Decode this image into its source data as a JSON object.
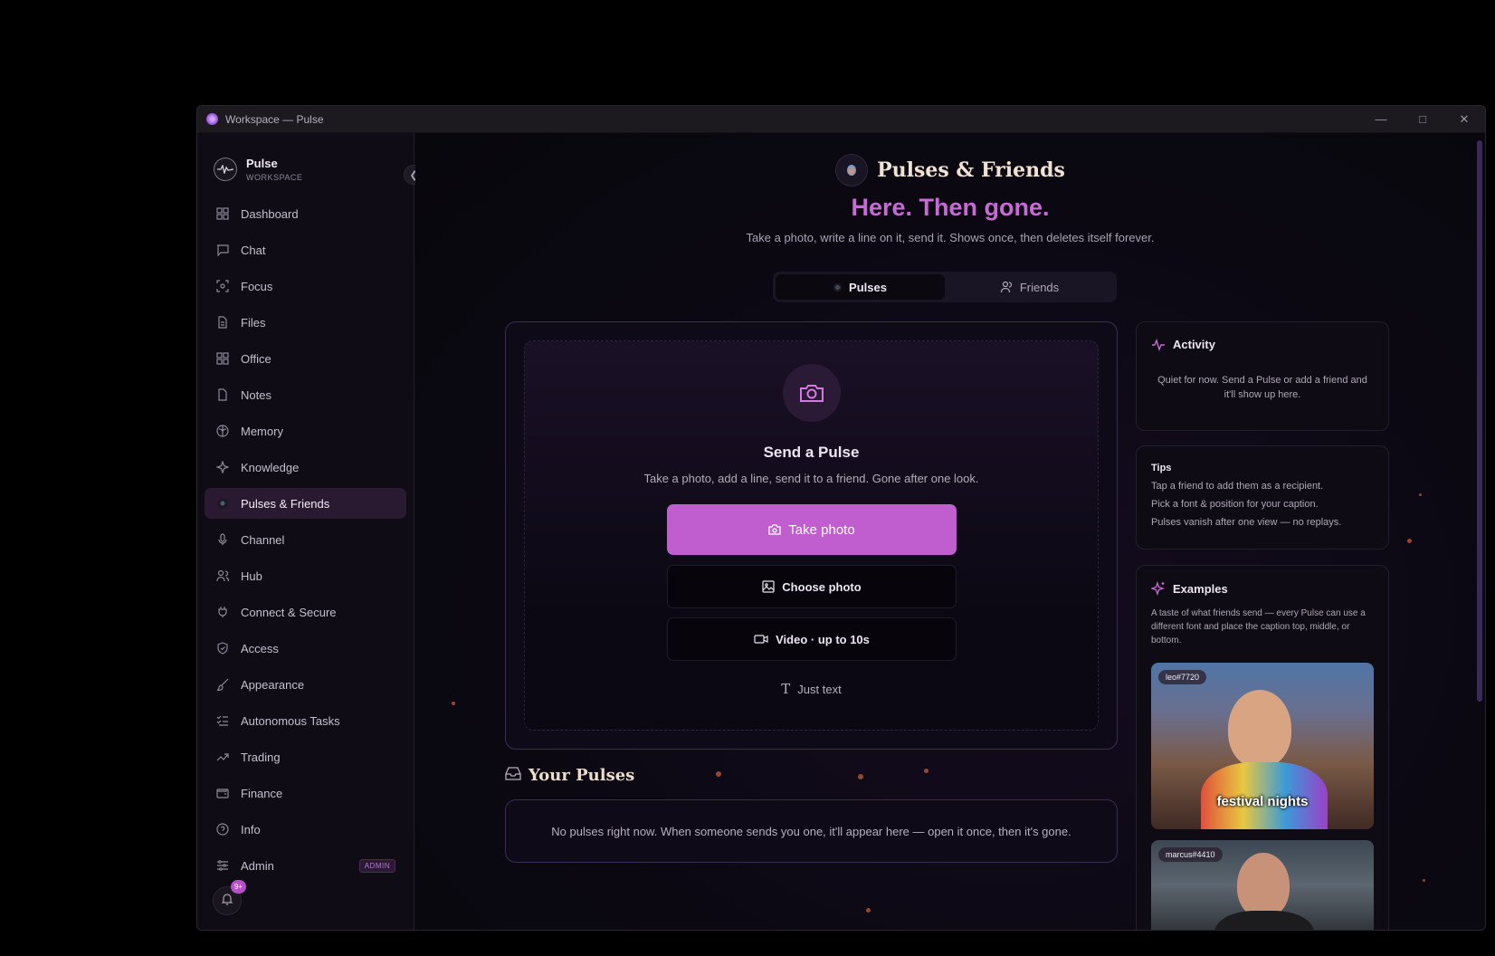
{
  "window": {
    "title": "Workspace — Pulse"
  },
  "brand": {
    "name": "Pulse",
    "sub": "WORKSPACE"
  },
  "nav": [
    {
      "label": "Dashboard",
      "icon": "grid-icon"
    },
    {
      "label": "Chat",
      "icon": "chat-icon"
    },
    {
      "label": "Focus",
      "icon": "focus-icon"
    },
    {
      "label": "Files",
      "icon": "file-icon"
    },
    {
      "label": "Office",
      "icon": "grid-icon"
    },
    {
      "label": "Notes",
      "icon": "note-icon"
    },
    {
      "label": "Memory",
      "icon": "brain-icon"
    },
    {
      "label": "Knowledge",
      "icon": "sparkle-icon"
    },
    {
      "label": "Pulses & Friends",
      "icon": "pulse-icon",
      "active": true
    },
    {
      "label": "Channel",
      "icon": "mic-icon"
    },
    {
      "label": "Hub",
      "icon": "users-icon"
    },
    {
      "label": "Connect & Secure",
      "icon": "plug-icon"
    },
    {
      "label": "Access",
      "icon": "shield-icon"
    },
    {
      "label": "Appearance",
      "icon": "brush-icon"
    },
    {
      "label": "Autonomous Tasks",
      "icon": "tasks-icon"
    },
    {
      "label": "Trading",
      "icon": "trend-icon"
    },
    {
      "label": "Finance",
      "icon": "wallet-icon"
    },
    {
      "label": "Info",
      "icon": "help-icon"
    },
    {
      "label": "Admin",
      "icon": "sliders-icon",
      "badge": "ADMIN"
    }
  ],
  "notifications": {
    "count": "9+"
  },
  "header": {
    "title": "Pulses & Friends",
    "tagline": "Here. Then gone.",
    "subtitle": "Take a photo, write a line on it, send it. Shows once, then deletes itself forever."
  },
  "tabs": {
    "pulses": "Pulses",
    "friends": "Friends"
  },
  "send": {
    "title": "Send a Pulse",
    "subtitle": "Take a photo, add a line, send it to a friend. Gone after one look.",
    "take_photo": "Take photo",
    "choose_photo": "Choose photo",
    "video": "Video · up to 10s",
    "just_text": "Just text"
  },
  "your_pulses": {
    "title": "Your Pulses",
    "empty": "No pulses right now. When someone sends you one, it'll appear here — open it once, then it's gone."
  },
  "activity": {
    "title": "Activity",
    "text": "Quiet for now. Send a Pulse or add a friend and it'll show up here."
  },
  "tips": {
    "title": "Tips",
    "items": [
      "Tap a friend to add them as a recipient.",
      "Pick a font & position for your caption.",
      "Pulses vanish after one view — no replays."
    ]
  },
  "examples": {
    "title": "Examples",
    "text": "A taste of what friends send — every Pulse can use a different font and place the caption top, middle, or bottom.",
    "cards": [
      {
        "user": "leo#7720",
        "caption": "festival nights"
      },
      {
        "user": "marcus#4410",
        "caption": ""
      }
    ]
  },
  "colors": {
    "accent": "#c05ed0",
    "tagline": "#c66ad4",
    "background": "#0b0812"
  }
}
